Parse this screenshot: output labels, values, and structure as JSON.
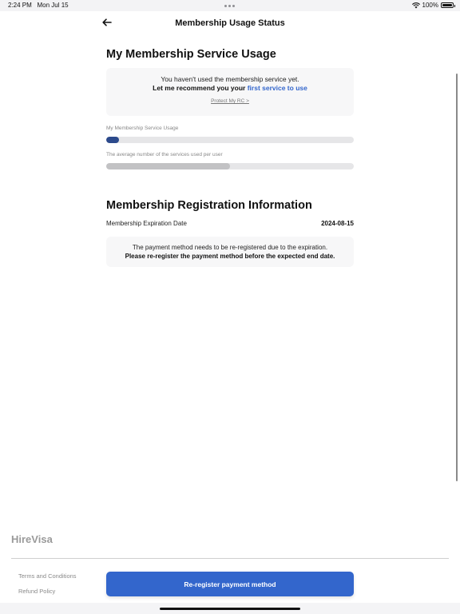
{
  "status_bar": {
    "time": "2:24 PM",
    "date": "Mon Jul 15",
    "battery_text": "100%",
    "icons": [
      "wifi-icon",
      "battery-icon"
    ]
  },
  "header": {
    "title": "Membership Usage Status",
    "back_icon": "arrow-left-icon"
  },
  "usage_section": {
    "title": "My Membership Service Usage",
    "card": {
      "line1": "You haven't used the membership service yet.",
      "line2_prefix": "Let me recommend you your ",
      "line2_highlight": "first service to use",
      "link": "Protect My RC >"
    },
    "bars": [
      {
        "label": "My Membership Service Usage",
        "value": 0.05,
        "color": "#2c4a8c"
      },
      {
        "label": "The average number of the services used per user",
        "value": 0.5,
        "color": "#c2c2c4"
      }
    ]
  },
  "registration_section": {
    "title": "Membership Registration Information",
    "expiration_label": "Membership Expiration Date",
    "expiration_value": "2024-08-15",
    "notice_line1": "The payment method needs to be re-registered due to the expiration.",
    "notice_line2": "Please re-register the payment method before the expected end date."
  },
  "footer": {
    "brand": "HireVisa",
    "links": [
      "Terms and Conditions",
      "Refund Policy"
    ],
    "primary_button": "Re-register payment method"
  },
  "colors": {
    "accent": "#3366cc",
    "usage_bar": "#2c4a8c",
    "average_bar": "#c2c2c4",
    "track": "#e6e6e8"
  }
}
